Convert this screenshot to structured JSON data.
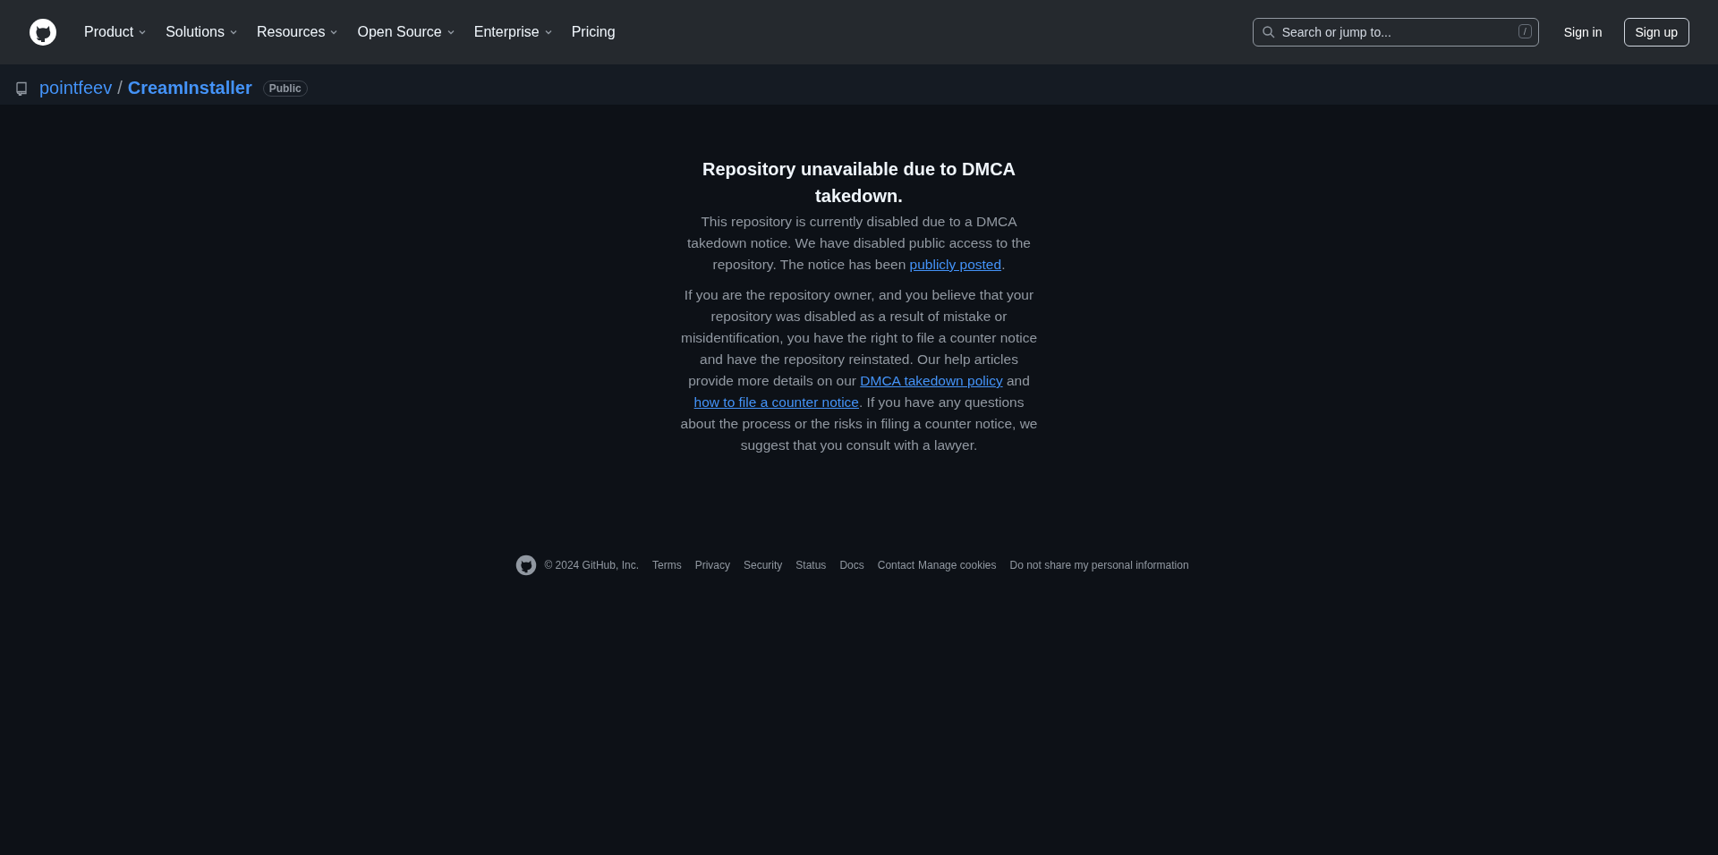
{
  "header": {
    "nav": [
      {
        "label": "Product",
        "dropdown": true
      },
      {
        "label": "Solutions",
        "dropdown": true
      },
      {
        "label": "Resources",
        "dropdown": true
      },
      {
        "label": "Open Source",
        "dropdown": true
      },
      {
        "label": "Enterprise",
        "dropdown": true
      },
      {
        "label": "Pricing",
        "dropdown": false
      }
    ],
    "search": {
      "placeholder": "Search or jump to...",
      "shortcut": "/"
    },
    "sign_in": "Sign in",
    "sign_up": "Sign up"
  },
  "repo": {
    "owner": "pointfeev",
    "separator": "/",
    "name": "CreamInstaller",
    "visibility": "Public"
  },
  "notice": {
    "title": "Repository unavailable due to DMCA takedown.",
    "paragraphs": [
      [
        {
          "kind": "text",
          "text": "This repository is currently disabled due to a DMCA takedown notice. We have disabled public access to the repository. The notice has been "
        },
        {
          "kind": "link",
          "text": "publicly posted"
        },
        {
          "kind": "text",
          "text": "."
        }
      ],
      [
        {
          "kind": "text",
          "text": "If you are the repository owner, and you believe that your repository was disabled as a result of mistake or misidentification, you have the right to file a counter notice and have the repository reinstated. Our help articles provide more details on our "
        },
        {
          "kind": "link",
          "text": "DMCA takedown policy"
        },
        {
          "kind": "text",
          "text": " and "
        },
        {
          "kind": "link",
          "text": "how to file a counter notice"
        },
        {
          "kind": "text",
          "text": ". If you have any questions about the process or the risks in filing a counter notice, we suggest that you consult with a lawyer."
        }
      ]
    ]
  },
  "footer": {
    "copyright": "© 2024 GitHub, Inc.",
    "links": [
      "Terms",
      "Privacy",
      "Security",
      "Status",
      "Docs",
      "Contact",
      "Manage cookies",
      "Do not share my personal information"
    ]
  }
}
